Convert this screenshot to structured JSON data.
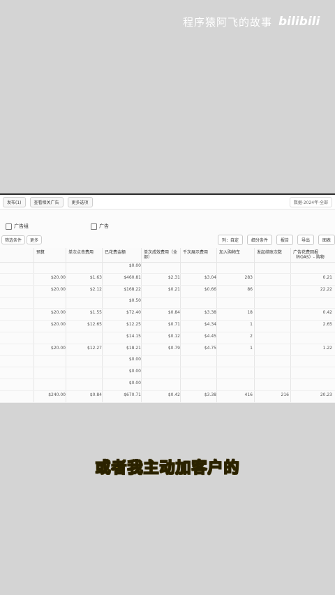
{
  "watermark": {
    "text": "程序猿阿飞的故事",
    "logo": "bilibili"
  },
  "caption": "或者我主动加客户的",
  "topbar": {
    "buttons": [
      "发布(1)",
      "查看相关广告",
      "更多选项"
    ],
    "right": "数据·2024年·全部"
  },
  "tabs": [
    {
      "label": "广告组",
      "icon": "folder-icon"
    },
    {
      "label": "广告",
      "icon": "ad-icon"
    }
  ],
  "filters": {
    "chip1": "筛选条件",
    "chip2": "更多"
  },
  "tools": [
    "列：自定",
    "细分条件",
    "报告",
    "导出",
    "图表"
  ],
  "columns": [
    "预算",
    "单次点击费用",
    "已花费金额",
    "单次成效费用（全部）",
    "千次展示费用",
    "加入购物车",
    "发起结账次数",
    "广告花费回报（ROAS）- 购物"
  ],
  "rows": [
    [
      "",
      "",
      "$0.00",
      "",
      "",
      "",
      "",
      ""
    ],
    [
      "$20.00",
      "$1.63",
      "$460.81",
      "$2.31",
      "$3.04",
      "283",
      "",
      "0.21"
    ],
    [
      "$20.00",
      "$2.12",
      "$168.22",
      "$0.21",
      "$0.66",
      "86",
      "",
      "22.22"
    ],
    [
      "",
      "",
      "$0.50",
      "",
      "",
      "",
      "",
      ""
    ],
    [
      "$20.00",
      "$1.55",
      "$72.40",
      "$0.84",
      "$3.38",
      "18",
      "",
      "0.42"
    ],
    [
      "$20.00",
      "$12.65",
      "$12.25",
      "$0.71",
      "$4.34",
      "1",
      "",
      "2.65"
    ],
    [
      "",
      "",
      "$14.15",
      "$0.12",
      "$4.45",
      "2",
      "",
      ""
    ],
    [
      "$20.00",
      "$12.27",
      "$18.21",
      "$0.79",
      "$4.75",
      "1",
      "",
      "1.22"
    ],
    [
      "",
      "",
      "$0.00",
      "",
      "",
      "",
      "",
      ""
    ],
    [
      "",
      "",
      "$0.00",
      "",
      "",
      "",
      "",
      ""
    ],
    [
      "",
      "",
      "$0.00",
      "",
      "",
      "",
      "",
      ""
    ],
    [
      "$240.00",
      "$0.84",
      "$670.71",
      "$0.42",
      "$3.38",
      "416",
      "216",
      "20.23"
    ]
  ]
}
